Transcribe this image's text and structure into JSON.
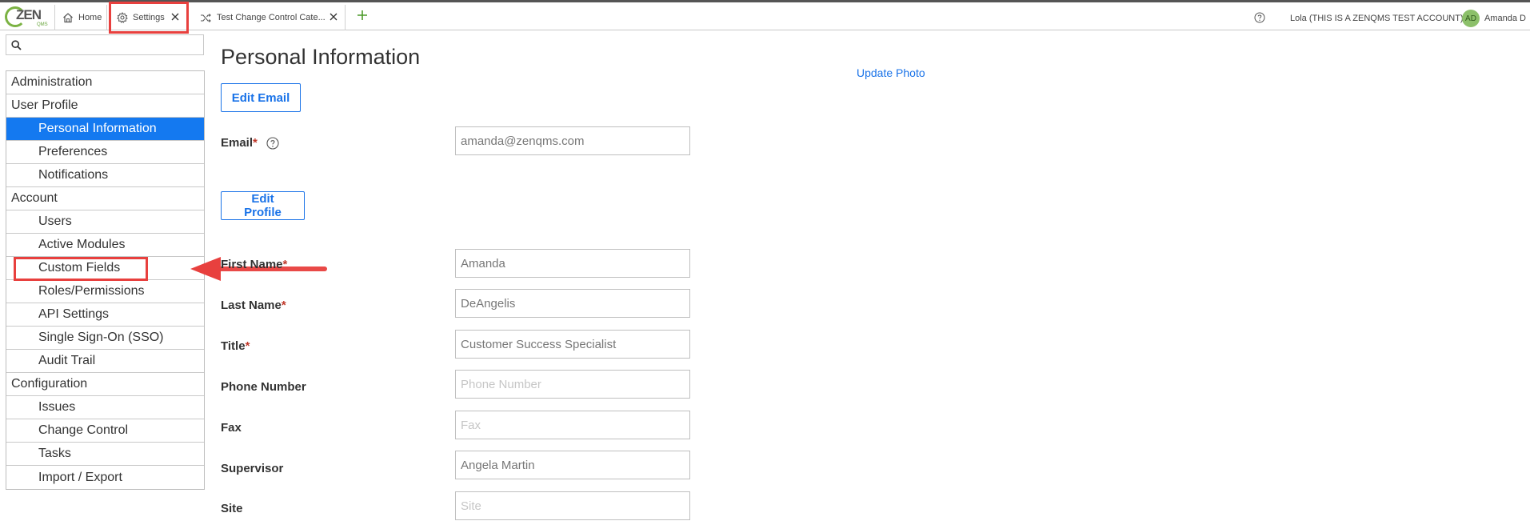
{
  "logo": {
    "brand": "ZEN",
    "sub": "QMS"
  },
  "tabs": [
    {
      "label": "Home",
      "icon": "home-icon"
    },
    {
      "label": "Settings",
      "icon": "gear-icon"
    },
    {
      "label": "Test Change Control Cate...",
      "icon": "shuffle-icon"
    }
  ],
  "header": {
    "account": "Lola (THIS IS A ZENQMS TEST ACCOUNT)",
    "avatar_initials": "AD",
    "user_name": "Amanda D",
    "avatar_color": "#8cc06a"
  },
  "search": {
    "value": "",
    "placeholder": ""
  },
  "sidebar": {
    "items": [
      {
        "label": "Administration",
        "level": "group"
      },
      {
        "label": "User Profile",
        "level": "group"
      },
      {
        "label": "Personal Information",
        "level": "sub",
        "active": true
      },
      {
        "label": "Preferences",
        "level": "sub"
      },
      {
        "label": "Notifications",
        "level": "sub"
      },
      {
        "label": "Account",
        "level": "group"
      },
      {
        "label": "Users",
        "level": "sub"
      },
      {
        "label": "Active Modules",
        "level": "sub"
      },
      {
        "label": "Custom Fields",
        "level": "sub",
        "highlighted": true
      },
      {
        "label": "Roles/Permissions",
        "level": "sub"
      },
      {
        "label": "API Settings",
        "level": "sub"
      },
      {
        "label": "Single Sign-On (SSO)",
        "level": "sub"
      },
      {
        "label": "Audit Trail",
        "level": "sub"
      },
      {
        "label": "Configuration",
        "level": "group"
      },
      {
        "label": "Issues",
        "level": "sub"
      },
      {
        "label": "Change Control",
        "level": "sub"
      },
      {
        "label": "Tasks",
        "level": "sub"
      },
      {
        "label": "Import / Export",
        "level": "sub"
      }
    ]
  },
  "main": {
    "title": "Personal Information",
    "update_photo": "Update Photo",
    "edit_email": "Edit Email",
    "edit_profile": "Edit Profile",
    "fields": {
      "email": {
        "label": "Email",
        "required": "*",
        "value": "amanda@zenqms.com"
      },
      "first_name": {
        "label": "First Name",
        "required": "*",
        "value": "Amanda"
      },
      "last_name": {
        "label": "Last Name",
        "required": "*",
        "value": "DeAngelis"
      },
      "title": {
        "label": "Title",
        "required": "*",
        "value": "Customer Success Specialist"
      },
      "phone": {
        "label": "Phone Number",
        "value": "",
        "placeholder": "Phone Number"
      },
      "fax": {
        "label": "Fax",
        "value": "",
        "placeholder": "Fax"
      },
      "supervisor": {
        "label": "Supervisor",
        "value": "Angela Martin"
      },
      "site": {
        "label": "Site",
        "value": "",
        "placeholder": "Site"
      }
    }
  },
  "colors": {
    "accent": "#1a73e8",
    "active_nav": "#1479f0",
    "annotation": "#e8403e",
    "logo_green": "#7bb243"
  }
}
